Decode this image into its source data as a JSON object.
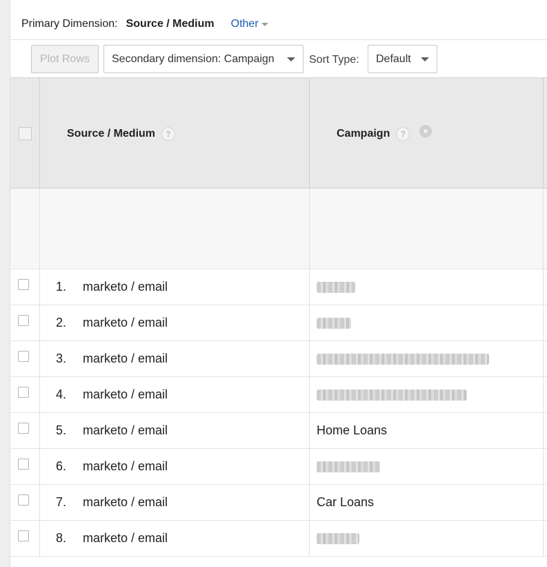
{
  "primary_dimension": {
    "label": "Primary Dimension:",
    "value": "Source / Medium",
    "other": "Other"
  },
  "toolbar": {
    "plot_rows": "Plot Rows",
    "secondary_dimension": "Secondary dimension: Campaign",
    "sort_type_label": "Sort Type:",
    "sort_type_value": "Default"
  },
  "table": {
    "columns": [
      "Source / Medium",
      "Campaign"
    ],
    "help_glyph": "?",
    "remove_glyph": "×",
    "rows": [
      {
        "index": "1.",
        "source": "marketo / email",
        "campaign": "",
        "campaign_redacted": true
      },
      {
        "index": "2.",
        "source": "marketo / email",
        "campaign": "",
        "campaign_redacted": true
      },
      {
        "index": "3.",
        "source": "marketo / email",
        "campaign": "",
        "campaign_redacted": true
      },
      {
        "index": "4.",
        "source": "marketo / email",
        "campaign": "",
        "campaign_redacted": true
      },
      {
        "index": "5.",
        "source": "marketo / email",
        "campaign": "Home Loans",
        "campaign_redacted": false
      },
      {
        "index": "6.",
        "source": "marketo / email",
        "campaign": "",
        "campaign_redacted": true
      },
      {
        "index": "7.",
        "source": "marketo / email",
        "campaign": "Car Loans",
        "campaign_redacted": false
      },
      {
        "index": "8.",
        "source": "marketo / email",
        "campaign": "",
        "campaign_redacted": true
      }
    ]
  },
  "colors": {
    "link": "#1a5bb5",
    "header_bg": "#e9e9e9",
    "totals_bg": "#f7f7f7"
  }
}
